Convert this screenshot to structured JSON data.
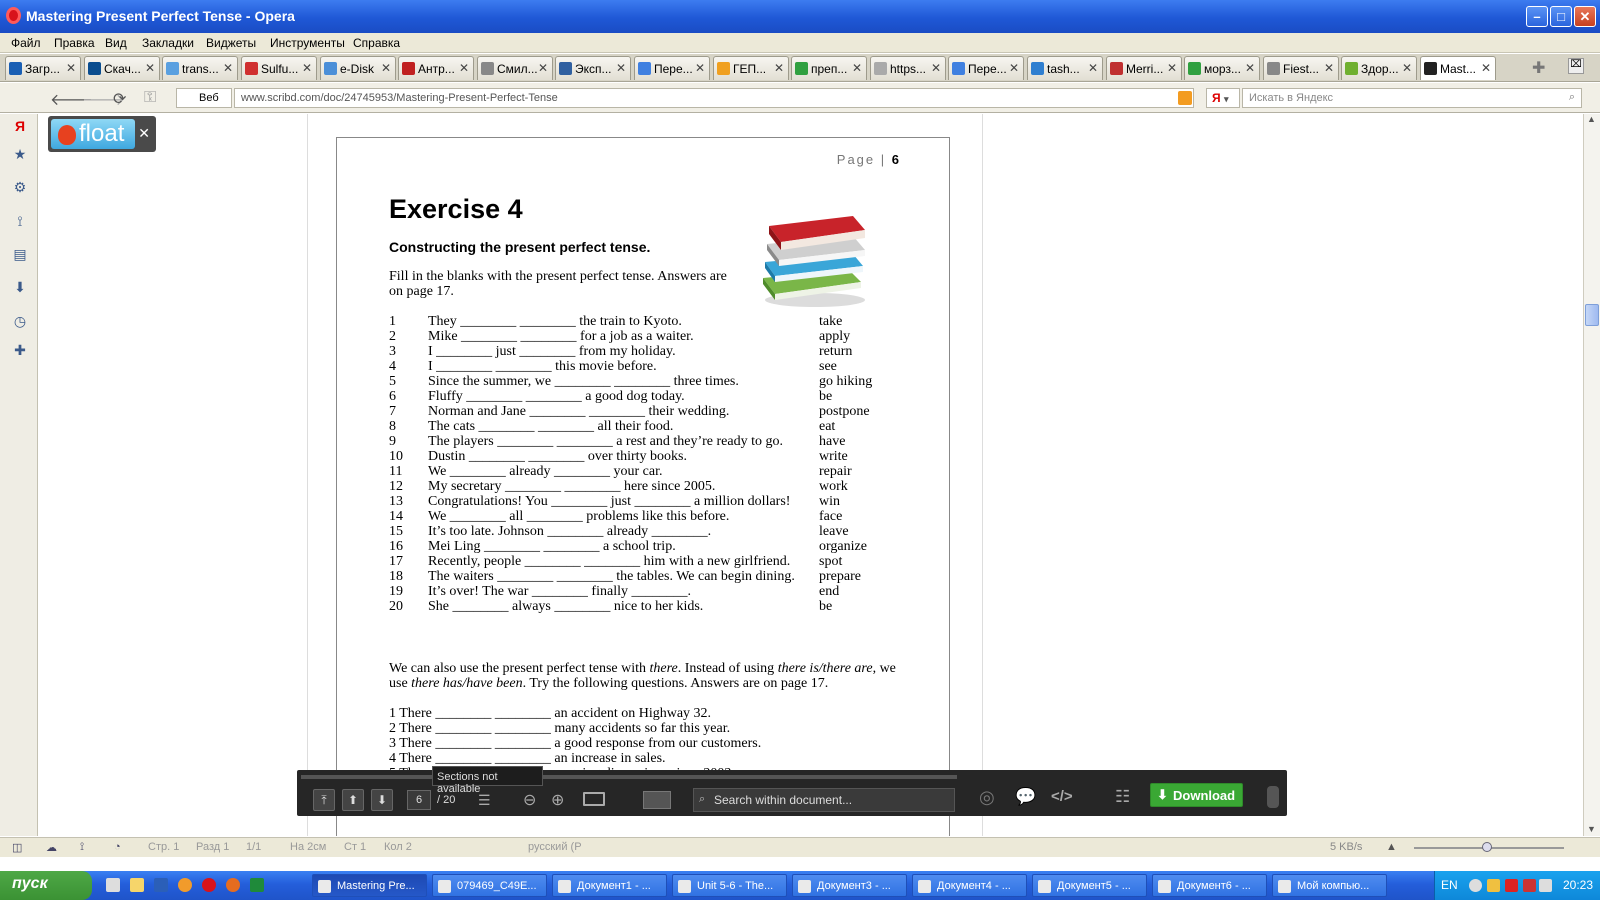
{
  "window": {
    "title": "Mastering Present Perfect Tense - Opera"
  },
  "menu": [
    "Файл",
    "Правка",
    "Вид",
    "Закладки",
    "Виджеты",
    "Инструменты",
    "Справка"
  ],
  "tabs": [
    {
      "label": "Загр...",
      "color": "#1a5fb4"
    },
    {
      "label": "Скач...",
      "color": "#0a4d8f"
    },
    {
      "label": "trans...",
      "color": "#5aa0e0"
    },
    {
      "label": "Sulfu...",
      "color": "#d03030"
    },
    {
      "label": "e-Disk",
      "color": "#4b8fd8"
    },
    {
      "label": "Антр...",
      "color": "#c02020"
    },
    {
      "label": "Смил...",
      "color": "#888888"
    },
    {
      "label": "Эксп...",
      "color": "#3060a0"
    },
    {
      "label": "Пере...",
      "color": "#4080e0"
    },
    {
      "label": "ГЕП...",
      "color": "#f0a020"
    },
    {
      "label": "преп...",
      "color": "#30a040"
    },
    {
      "label": "https...",
      "color": "#aaaaaa"
    },
    {
      "label": "Пере...",
      "color": "#4080e0"
    },
    {
      "label": "tash...",
      "color": "#2f7fd0"
    },
    {
      "label": "Merri...",
      "color": "#c03030"
    },
    {
      "label": "морз...",
      "color": "#30a040"
    },
    {
      "label": "Fiest...",
      "color": "#888888"
    },
    {
      "label": "Здор...",
      "color": "#70b030"
    },
    {
      "label": "Mast...",
      "color": "#222222"
    }
  ],
  "nav": {
    "web_label": "Веб",
    "url": "www.scribd.com/doc/24745953/Mastering-Present-Perfect-Tense",
    "search_engine": "Я",
    "search_placeholder": "Искать в Яндекс"
  },
  "float_widget": {
    "label": "float"
  },
  "document": {
    "page_label": "Page",
    "page_number": "6",
    "title": "Exercise 4",
    "subtitle": "Constructing the present perfect tense.",
    "intro": "Fill in the blanks with the present perfect tense. Answers are on page 17.",
    "questions": [
      {
        "n": "1",
        "s": "They ________ ________ the train to Kyoto.",
        "v": "take"
      },
      {
        "n": "2",
        "s": "Mike ________ ________ for a job as a waiter.",
        "v": "apply"
      },
      {
        "n": "3",
        "s": "I ________ just ________ from my holiday.",
        "v": "return"
      },
      {
        "n": "4",
        "s": "I ________ ________ this movie before.",
        "v": "see"
      },
      {
        "n": "5",
        "s": "Since the summer, we ________ ________ three times.",
        "v": "go hiking"
      },
      {
        "n": "6",
        "s": "Fluffy ________ ________ a good dog today.",
        "v": "be"
      },
      {
        "n": "7",
        "s": "Norman and Jane ________ ________ their wedding.",
        "v": "postpone"
      },
      {
        "n": "8",
        "s": "The cats ________ ________ all their food.",
        "v": "eat"
      },
      {
        "n": "9",
        "s": "The players ________ ________ a rest and they’re ready to go.",
        "v": "have"
      },
      {
        "n": "10",
        "s": "Dustin ________ ________ over thirty books.",
        "v": "write"
      },
      {
        "n": "11",
        "s": "We ________ already ________ your car.",
        "v": "repair"
      },
      {
        "n": "12",
        "s": "My secretary ________ ________ here since 2005.",
        "v": "work"
      },
      {
        "n": "13",
        "s": "Congratulations! You ________ just ________ a million dollars!",
        "v": "win"
      },
      {
        "n": "14",
        "s": "We ________ all ________ problems like this before.",
        "v": "face"
      },
      {
        "n": "15",
        "s": "It’s too late. Johnson ________ already ________.",
        "v": "leave"
      },
      {
        "n": "16",
        "s": "Mei Ling ________ ________ a school trip.",
        "v": "organize"
      },
      {
        "n": "17",
        "s": "Recently, people ________ ________ him with a new girlfriend.",
        "v": "spot"
      },
      {
        "n": "18",
        "s": "The waiters ________ ________ the tables. We can begin dining.",
        "v": "prepare"
      },
      {
        "n": "19",
        "s": "It’s over! The war ________ finally ________.",
        "v": "end"
      },
      {
        "n": "20",
        "s": "She ________ always ________ nice to her kids.",
        "v": "be"
      }
    ],
    "there_intro_1": "We can also use the present perfect tense with ",
    "there_em_1": "there",
    "there_intro_2": ". Instead of using ",
    "there_em_2": "there is/there are",
    "there_intro_3": ", we use ",
    "there_em_3": "there has/have been",
    "there_intro_4": ". Try the following questions. Answers are on page 17.",
    "there_questions": [
      "1 There ________ ________ an accident on Highway 32.",
      "2 There ________ ________ many accidents so far this year.",
      "3 There ________ ________ a good response from our customers.",
      "4 There ________ ________ an increase in sales.",
      "5 There ________ ________ ongoing discussions since 2003."
    ]
  },
  "scribd_toolbar": {
    "tooltip": "Sections not available",
    "current_page": "6",
    "total_pages": "/ 20",
    "search_placeholder": "Search within document...",
    "download_label": "Download"
  },
  "statusbar": {
    "left_items": [
      "Стр. 1",
      "Разд 1",
      "1/1",
      "На 2см",
      "Ст 1",
      "Кол 2"
    ],
    "lang": "русский (Р",
    "speed": "5 KB/s"
  },
  "taskbar": {
    "start_label": "пуск",
    "tasks": [
      {
        "label": "Mastering Pre...",
        "active": true
      },
      {
        "label": "079469_C49E...",
        "active": false
      },
      {
        "label": "Документ1 - ...",
        "active": false
      },
      {
        "label": "Unit 5-6 - The...",
        "active": false
      },
      {
        "label": "Документ3 - ...",
        "active": false
      },
      {
        "label": "Документ4 - ...",
        "active": false
      },
      {
        "label": "Документ5 - ...",
        "active": false
      },
      {
        "label": "Документ6 - ...",
        "active": false
      },
      {
        "label": "Мой компью...",
        "active": false
      }
    ],
    "lang": "EN",
    "time": "20:23"
  }
}
